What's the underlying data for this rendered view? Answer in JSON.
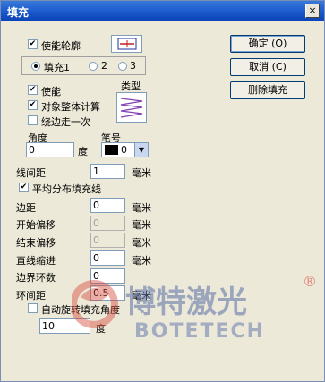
{
  "window": {
    "title": "填充",
    "close": "×"
  },
  "outline": {
    "enable_label": "使能轮廓"
  },
  "fills": {
    "options": [
      "填充1",
      "2",
      "3"
    ],
    "selected": 0
  },
  "fill": {
    "enable_label": "使能",
    "whole_object_label": "对象整体计算",
    "edge_once_label": "绕边走一次",
    "type_label": "类型",
    "angle_label": "角度",
    "angle_value": "0",
    "degree_unit": "度",
    "pen_label": "笔号",
    "pen_value": "0",
    "line_spacing_label": "线间距",
    "line_spacing_value": "1",
    "mm_unit": "毫米",
    "distribute_label": "平均分布填充线",
    "margin_label": "边距",
    "margin_value": "0",
    "start_offset_label": "开始偏移",
    "start_offset_value": "0",
    "end_offset_label": "结束偏移",
    "end_offset_value": "0",
    "line_indent_label": "直线缩进",
    "line_indent_value": "0",
    "border_loops_label": "边界环数",
    "border_loops_value": "0",
    "loop_spacing_label": "环间距",
    "loop_spacing_value": "0.5",
    "auto_rotate_label": "自动旋转填充角度",
    "rotate_value": "10",
    "rotate_unit": "度"
  },
  "buttons": {
    "ok": "确定 (O)",
    "cancel": "取消 (C)",
    "delete": "删除填充"
  },
  "watermark": {
    "brand_cn": "博特激光",
    "brand_en": "BOTETECH",
    "registered": "®"
  },
  "colors": {
    "title_bar": "#0b44b8",
    "dialog_bg": "#ece9d8",
    "hatch_purple": "#8040b0",
    "watermark_red": "#d84a3c",
    "watermark_blue": "#5a6fa8"
  }
}
